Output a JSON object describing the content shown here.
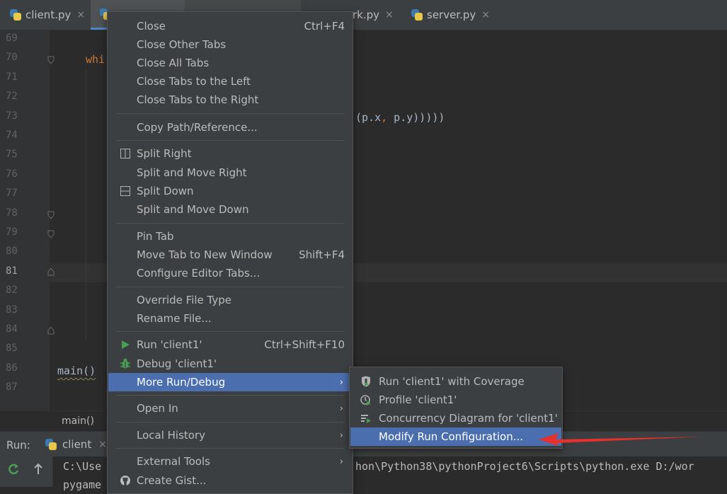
{
  "tabs": [
    {
      "label": "client.py",
      "close": "×"
    },
    {
      "label": "",
      "close": ""
    },
    {
      "label": "",
      "close": ""
    },
    {
      "label": "rk.py",
      "close": "×"
    },
    {
      "label": "server.py",
      "close": "×"
    }
  ],
  "editor": {
    "line_numbers": [
      "69",
      "70",
      "71",
      "72",
      "73",
      "74",
      "75",
      "76",
      "77",
      "78",
      "79",
      "80",
      "81",
      "82",
      "83",
      "84",
      "85",
      "86",
      "87"
    ],
    "current_line": "81",
    "code_fragments": {
      "whi": "whi",
      "pxpy_a": "(p.x",
      "pxpy_comma": ",",
      "pxpy_b": " p.y)))))",
      "main": "main()"
    }
  },
  "breadcrumb": {
    "text": "main()"
  },
  "run_panel": {
    "label": "Run:",
    "tab_label": "client",
    "tab_close": "×",
    "console_lines": [
      "C:\\Use",
      "pygame",
      "hon\\Python38\\pythonProject6\\Scripts\\python.exe D:/wor"
    ]
  },
  "context_menu": {
    "close": {
      "label": "Close",
      "shortcut": "Ctrl+F4"
    },
    "close_other_tabs": {
      "label": "Close Other Tabs"
    },
    "close_all_tabs": {
      "label": "Close All Tabs"
    },
    "close_tabs_left": {
      "label": "Close Tabs to the Left"
    },
    "close_tabs_right": {
      "label": "Close Tabs to the Right"
    },
    "copy_path": {
      "label": "Copy Path/Reference..."
    },
    "split_right": {
      "label": "Split Right"
    },
    "split_move_right": {
      "label": "Split and Move Right"
    },
    "split_down": {
      "label": "Split Down"
    },
    "split_move_down": {
      "label": "Split and Move Down"
    },
    "pin_tab": {
      "label": "Pin Tab"
    },
    "move_tab": {
      "label": "Move Tab to New Window",
      "shortcut": "Shift+F4"
    },
    "configure_tabs": {
      "label": "Configure Editor Tabs..."
    },
    "override_type": {
      "label": "Override File Type"
    },
    "rename_file": {
      "label": "Rename File..."
    },
    "run": {
      "label": "Run 'client1'",
      "shortcut": "Ctrl+Shift+F10"
    },
    "debug": {
      "label": "Debug 'client1'"
    },
    "more_run_debug": {
      "label": "More Run/Debug"
    },
    "open_in": {
      "label": "Open In"
    },
    "local_history": {
      "label": "Local History"
    },
    "external_tools": {
      "label": "External Tools"
    },
    "create_gist": {
      "label": "Create Gist..."
    },
    "submenu_arrow": "›"
  },
  "submenu": {
    "coverage": {
      "label": "Run 'client1' with Coverage"
    },
    "profile": {
      "label": "Profile 'client1'"
    },
    "concurrency": {
      "label": "Concurrency Diagram for 'client1'"
    },
    "modify": {
      "label": "Modify Run Configuration..."
    }
  },
  "colors": {
    "selection": "#4b6eaf",
    "run_green": "#499c54",
    "annotation_red": "#e8302c"
  }
}
